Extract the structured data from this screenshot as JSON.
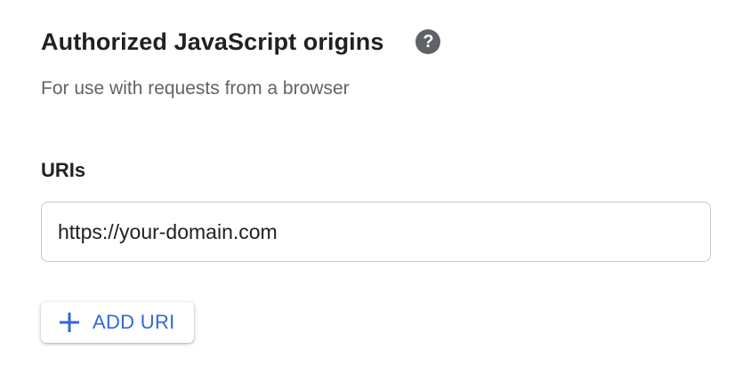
{
  "section": {
    "title": "Authorized JavaScript origins",
    "help_icon": "help-question-icon",
    "subtitle": "For use with requests from a browser"
  },
  "uris": {
    "label": "URIs",
    "items": [
      {
        "value": "https://your-domain.com"
      }
    ]
  },
  "add_button": {
    "icon": "plus-icon",
    "label": "ADD URI"
  },
  "colors": {
    "accent": "#3367d6",
    "heading": "#202124",
    "secondary_text": "#5f6368",
    "border": "#c4c7c5"
  }
}
